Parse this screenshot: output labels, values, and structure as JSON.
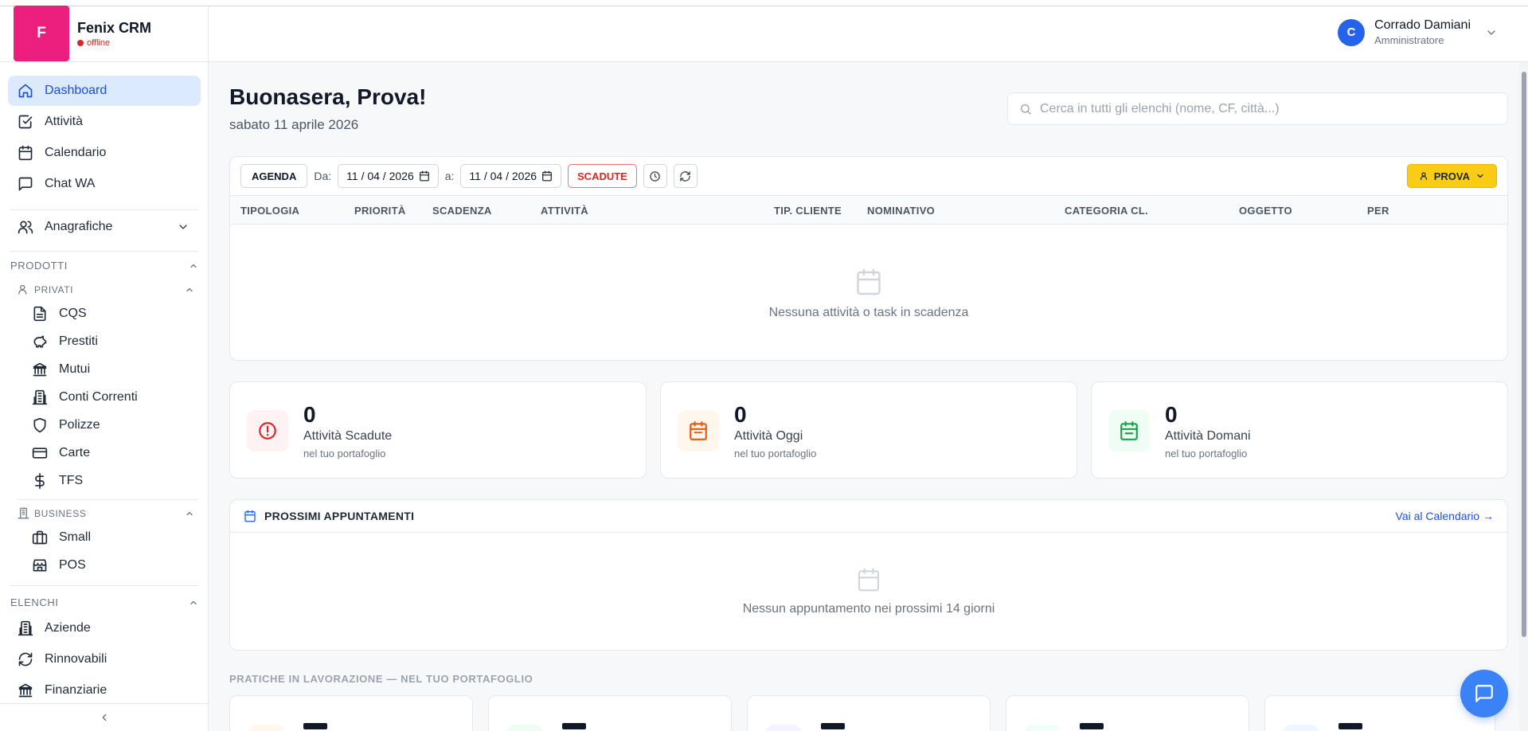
{
  "brand": {
    "logo_letter": "F",
    "name": "Fenix CRM",
    "status": "offline"
  },
  "user": {
    "initial": "C",
    "name": "Corrado Damiani",
    "role": "Amministratore"
  },
  "sidebar": {
    "top_items": [
      {
        "label": "Dashboard",
        "icon": "home-icon",
        "active": true
      },
      {
        "label": "Attività",
        "icon": "check-square-icon"
      },
      {
        "label": "Calendario",
        "icon": "calendar-icon"
      },
      {
        "label": "Chat WA",
        "icon": "chat-icon"
      }
    ],
    "anagrafiche": "Anagrafiche",
    "prodotti_label": "PRODOTTI",
    "privati_label": "PRIVATI",
    "privati_items": [
      {
        "label": "CQS",
        "icon": "document-icon"
      },
      {
        "label": "Prestiti",
        "icon": "piggy-bank-icon"
      },
      {
        "label": "Mutui",
        "icon": "bank-icon"
      },
      {
        "label": "Conti Correnti",
        "icon": "building-icon"
      },
      {
        "label": "Polizze",
        "icon": "shield-icon"
      },
      {
        "label": "Carte",
        "icon": "credit-card-icon"
      },
      {
        "label": "TFS",
        "icon": "dollar-icon"
      }
    ],
    "business_label": "BUSINESS",
    "business_items": [
      {
        "label": "Small",
        "icon": "briefcase-icon"
      },
      {
        "label": "POS",
        "icon": "store-icon"
      }
    ],
    "elenchi_label": "ELENCHI",
    "elenchi_items": [
      {
        "label": "Aziende",
        "icon": "building-icon"
      },
      {
        "label": "Rinnovabili",
        "icon": "refresh-icon"
      },
      {
        "label": "Finanziarie",
        "icon": "bank-icon"
      }
    ]
  },
  "main": {
    "greeting": "Buonasera, Prova!",
    "date": "sabato 11 aprile 2026",
    "search_placeholder": "Cerca in tutti gli elenchi (nome, CF, città...)"
  },
  "agenda": {
    "agenda_button": "AGENDA",
    "from_label": "Da:",
    "from_date": "11 / 04 / 2026",
    "to_label": "a:",
    "to_date": "11 / 04 / 2026",
    "expired_button": "SCADUTE",
    "user_button": "PROVA",
    "columns": [
      "TIPOLOGIA",
      "PRIORITÀ",
      "SCADENZA",
      "ATTIVITÀ",
      "TIP. CLIENTE",
      "NOMINATIVO",
      "CATEGORIA CL.",
      "OGGETTO",
      "PER"
    ],
    "empty_text": "Nessuna attività o task in scadenza"
  },
  "stats": [
    {
      "value": "0",
      "label": "Attività Scadute",
      "sub": "nel tuo portafoglio",
      "color": "#dc2626",
      "bg": "#fef2f2"
    },
    {
      "value": "0",
      "label": "Attività Oggi",
      "sub": "nel tuo portafoglio",
      "color": "#ea580c",
      "bg": "#fff7ed"
    },
    {
      "value": "0",
      "label": "Attività Domani",
      "sub": "nel tuo portafoglio",
      "color": "#16a34a",
      "bg": "#f0fdf4"
    }
  ],
  "appointments": {
    "title": "PROSSIMI APPUNTAMENTI",
    "link": "Vai al Calendario →",
    "empty_text": "Nessun appuntamento nei prossimi 14 giorni"
  },
  "pratiche": {
    "title": "PRATICHE IN LAVORAZIONE — NEL TUO PORTAFOGLIO"
  },
  "colors": {
    "accent": "#2563eb",
    "brand": "#ec1e7e",
    "warning": "#facc15"
  }
}
